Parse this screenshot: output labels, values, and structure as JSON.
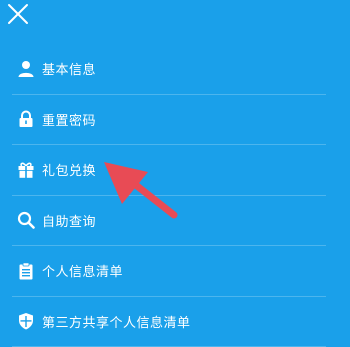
{
  "close": {
    "icon": "close-icon"
  },
  "menu": {
    "items": [
      {
        "label": "基本信息",
        "icon": "person-icon"
      },
      {
        "label": "重置密码",
        "icon": "lock-icon"
      },
      {
        "label": "礼包兑换",
        "icon": "gift-icon"
      },
      {
        "label": "自助查询",
        "icon": "search-icon"
      },
      {
        "label": "个人信息清单",
        "icon": "clipboard-icon"
      },
      {
        "label": "第三方共享个人信息清单",
        "icon": "shield-icon"
      }
    ]
  },
  "colors": {
    "background": "#1aa0ea",
    "text": "#ffffff",
    "annotation_arrow": "#e84b55"
  }
}
